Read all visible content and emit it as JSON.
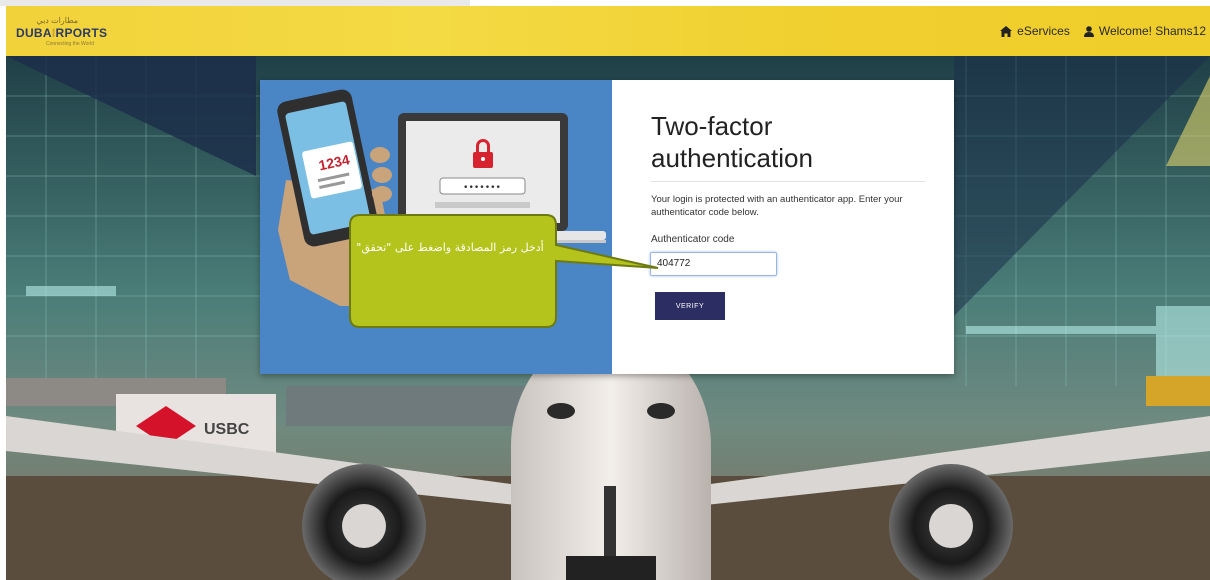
{
  "header": {
    "logo_arabic": "مطارات دبي",
    "logo_text_dubai": "DUBA",
    "logo_text_i": "I",
    "logo_text_rports": "RPORTS",
    "logo_tagline": "Connecting the World",
    "nav": [
      {
        "icon": "home-icon",
        "label": "eServices"
      },
      {
        "icon": "user-icon",
        "label": "Welcome! Shams12"
      }
    ]
  },
  "illustration": {
    "phone_code": "1234",
    "password_mask": "•••••••"
  },
  "auth": {
    "title": "Two-factor authentication",
    "description": "Your login is protected with an authenticator app. Enter your authenticator code below.",
    "code_label": "Authenticator code",
    "code_value": "404772",
    "verify_label": "VERIFY"
  },
  "callout": {
    "text": "أدخل رمز المصادقة واضغط على \"تحقق\""
  },
  "colors": {
    "header": "#f2d23a",
    "panel_blue": "#4a86c6",
    "verify_button": "#2c2d62",
    "callout_fill": "#b4c41c",
    "callout_border": "#6d7a12"
  }
}
